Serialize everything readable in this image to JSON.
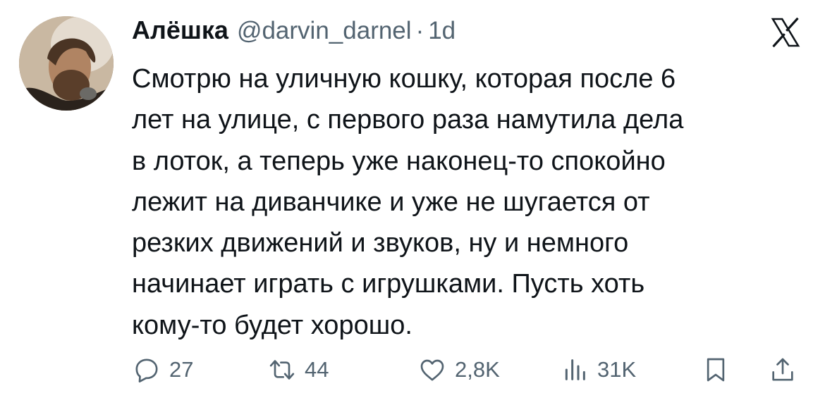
{
  "author": {
    "display_name": "Алёшка",
    "handle": "@darvin_darnel",
    "separator": "·",
    "time": "1d"
  },
  "brand": {
    "logo_icon": "x-logo-icon"
  },
  "tweet": {
    "lines": [
      "Смотрю на уличную кошку, которая после 6",
      "лет на улице, с первого раза  намутила дела",
      "в лоток, а теперь уже наконец-то спокойно",
      "лежит на диванчике и уже не шугается от",
      "резких движений и звуков, ну и немного",
      "начинает играть с игрушками. Пусть хоть",
      "кому-то будет хорошо."
    ]
  },
  "actions": {
    "reply": {
      "icon": "reply-icon",
      "count": "27"
    },
    "retweet": {
      "icon": "retweet-icon",
      "count": "44"
    },
    "like": {
      "icon": "heart-icon",
      "count": "2,8K"
    },
    "views": {
      "icon": "views-icon",
      "count": "31K"
    },
    "bookmark": {
      "icon": "bookmark-icon"
    },
    "share": {
      "icon": "share-icon"
    }
  },
  "colors": {
    "text_primary": "#0f1419",
    "text_secondary": "#536471",
    "background": "#ffffff"
  }
}
